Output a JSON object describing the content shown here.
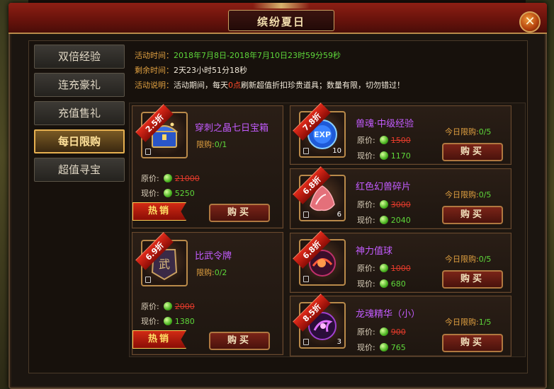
{
  "window": {
    "title": "缤纷夏日"
  },
  "colors": {
    "accent": "#e0a040",
    "green": "#5ed83a",
    "red": "#ff4a2a",
    "purple": "#c35cff"
  },
  "tabs": [
    {
      "label": "双倍经验",
      "active": false
    },
    {
      "label": "连充豪礼",
      "active": false
    },
    {
      "label": "充值售礼",
      "active": false
    },
    {
      "label": "每日限购",
      "active": true
    },
    {
      "label": "超值寻宝",
      "active": false
    }
  ],
  "info": {
    "time_label": "活动时间：",
    "time_value": "2018年7月8日-2018年7月10日23时59分59秒",
    "remain_label": "剩余时间：",
    "remain_value": "2天23小时51分18秒",
    "desc_label": "活动说明：",
    "desc_prefix": "活动期间，每天",
    "desc_highlight": "0点",
    "desc_suffix": "刷新超值折扣珍贵道具；数量有限，切勿错过！"
  },
  "labels": {
    "orig": "原价:",
    "now": "现价:",
    "limit": "限购:",
    "daily_limit": "今日限购:",
    "buy": "购买",
    "hot": "热销"
  },
  "left_items": [
    {
      "name": "穿刺之晶七日宝箱",
      "discount": "2.5折",
      "limit": "0/1",
      "orig": "21000",
      "now": "5250",
      "icon": "treasure-chest-icon"
    },
    {
      "name": "比武令牌",
      "discount": "6.9折",
      "limit": "0/2",
      "orig": "2000",
      "now": "1380",
      "icon": "token-plaque-icon"
    }
  ],
  "right_items": [
    {
      "name": "兽魂·中级经验",
      "discount": "7.8折",
      "limit": "0/5",
      "orig": "1500",
      "now": "1170",
      "count": "10",
      "icon": "exp-orb-icon"
    },
    {
      "name": "红色幻兽碎片",
      "discount": "6.8折",
      "limit": "0/5",
      "orig": "3000",
      "now": "2040",
      "count": "6",
      "icon": "red-shard-icon"
    },
    {
      "name": "神力值球",
      "discount": "6.8折",
      "limit": "0/5",
      "orig": "1000",
      "now": "680",
      "count": "",
      "icon": "power-orb-icon"
    },
    {
      "name": "龙魂精华（小）",
      "discount": "8.5折",
      "limit": "1/5",
      "orig": "900",
      "now": "765",
      "count": "3",
      "icon": "dragon-essence-icon"
    }
  ]
}
